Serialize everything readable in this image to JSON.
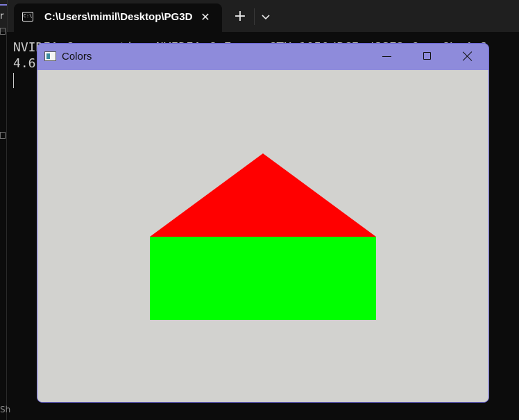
{
  "terminal": {
    "tab_title": "C:\\Users\\mimil\\Desktop\\PG3D",
    "tab_icon_text": "C:\\",
    "new_tab_symbol": "+",
    "close_symbol": "✕",
    "dropdown_symbol": "⌄",
    "left_strip_text": "r",
    "output_line1": "NVIDIA Corporation NVIDIA GeForce GTX 1050/PCIe/SSE2 OpenGL 4.6",
    "output_line2": "4.6",
    "side_text": "Sh"
  },
  "window": {
    "title": "Colors",
    "titlebar_color": "#8e8bdb",
    "background_color": "#d2d2cf"
  },
  "scene": {
    "roof": {
      "shape": "triangle",
      "color": "#ff0000"
    },
    "body": {
      "shape": "rectangle",
      "color": "#00ff00"
    }
  },
  "icons": {
    "terminal": "terminal-icon",
    "close": "close-icon",
    "add": "plus-icon",
    "dropdown": "chevron-down-icon",
    "app": "window-icon",
    "minimize": "minimize-icon",
    "maximize": "maximize-icon",
    "window_close": "close-icon"
  }
}
